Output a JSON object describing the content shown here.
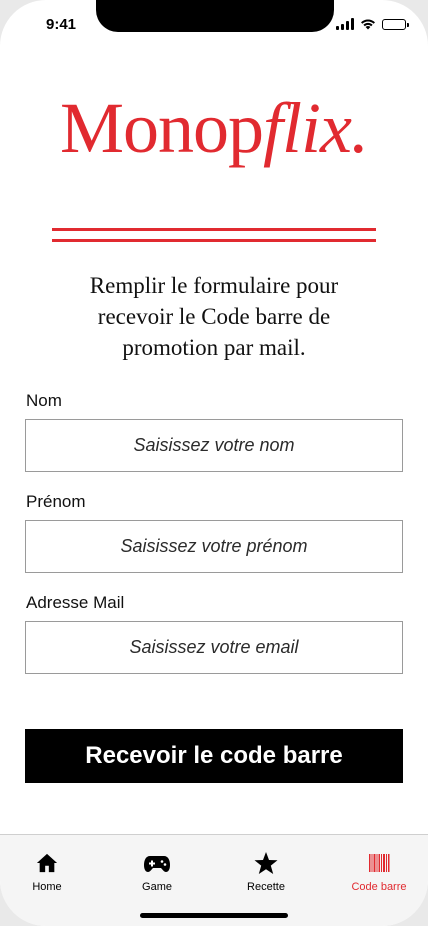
{
  "status": {
    "time": "9:41"
  },
  "brand": {
    "part1": "Monop",
    "part2": "flix.",
    "color": "#e12a30"
  },
  "intro": {
    "line1": "Remplir le formulaire pour",
    "line2": "recevoir le Code barre de",
    "line3": "promotion par mail."
  },
  "form": {
    "nom": {
      "label": "Nom",
      "placeholder": "Saisissez votre nom"
    },
    "prenom": {
      "label": "Prénom",
      "placeholder": "Saisissez votre prénom"
    },
    "email": {
      "label": "Adresse Mail",
      "placeholder": "Saisissez votre email"
    },
    "submit_label": "Recevoir le code barre"
  },
  "tabs": [
    {
      "label": "Home",
      "icon": "home-icon",
      "active": false
    },
    {
      "label": "Game",
      "icon": "gamepad-icon",
      "active": false
    },
    {
      "label": "Recette",
      "icon": "star-icon",
      "active": false
    },
    {
      "label": "Code barre",
      "icon": "barcode-icon",
      "active": true
    }
  ],
  "accent": "#e12a30"
}
